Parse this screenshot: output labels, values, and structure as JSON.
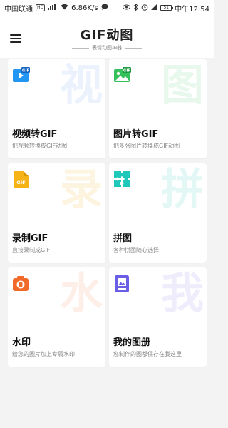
{
  "status_bar": {
    "carrier": "中国联通",
    "network_badge": "HD",
    "signal": "4G",
    "speed": "6.86K/s",
    "battery": "51",
    "time": "中午12:54"
  },
  "app_bar": {
    "title": "GIF动图",
    "subtitle": "表情动图神器"
  },
  "cards": [
    {
      "title": "视频转GIF",
      "desc": "把视频转换成GIF动图",
      "watermark": "视",
      "icon": "video-gif-icon",
      "color": "#2196f3",
      "wm_color": "#dbe8fb",
      "icon_label": "GIF"
    },
    {
      "title": "图片转GIF",
      "desc": "把多张图片转换成GIF动图",
      "watermark": "图",
      "icon": "image-gif-icon",
      "color": "#34c05a",
      "wm_color": "#d7f2de",
      "icon_label": "GIF"
    },
    {
      "title": "录制GIF",
      "desc": "直接录制成GIF",
      "watermark": "录",
      "icon": "record-gif-icon",
      "color": "#f5b316",
      "wm_color": "#fcecc8",
      "icon_label": "GIF"
    },
    {
      "title": "拼图",
      "desc": "各种拼图随心选择",
      "watermark": "拼",
      "icon": "puzzle-icon",
      "color": "#1fc8b8",
      "wm_color": "#cdf2ee",
      "icon_label": ""
    },
    {
      "title": "水印",
      "desc": "给您的图片加上专属水印",
      "watermark": "水",
      "icon": "watermark-camera-icon",
      "color": "#f26a2a",
      "wm_color": "#fde2d6",
      "icon_label": ""
    },
    {
      "title": "我的图册",
      "desc": "您制作的图都保存在我这里",
      "watermark": "我",
      "icon": "album-icon",
      "color": "#6b5ee6",
      "wm_color": "#e2dff9",
      "icon_label": ""
    }
  ]
}
